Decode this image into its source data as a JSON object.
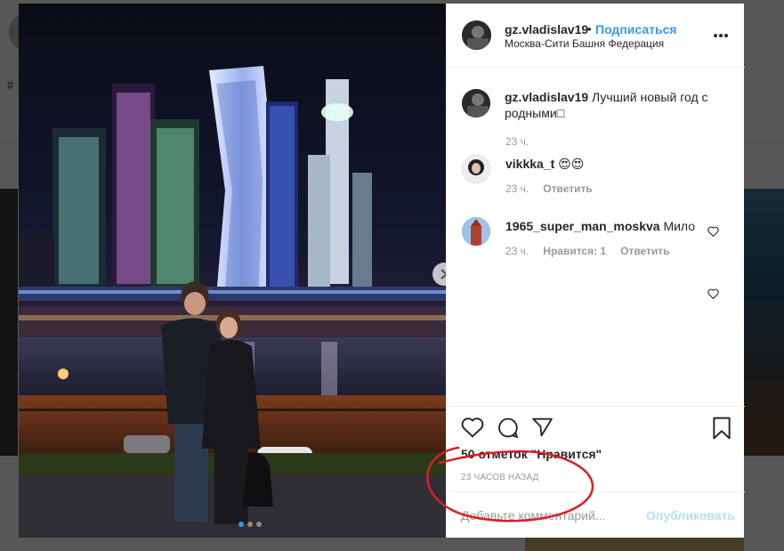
{
  "header": {
    "username": "gz.vladislav19",
    "separator": "•",
    "follow_label": "Подписаться",
    "location": "Москва-Сити Башня Федерация",
    "more_icon": "more-dots-icon"
  },
  "caption": {
    "username": "gz.vladislav19",
    "text": " Лучший новый год с родными",
    "trailing_glyph": "□",
    "time": "23 ч."
  },
  "comments": [
    {
      "username": "vikkka_t",
      "text": " 😍😍",
      "time": "23 ч.",
      "actions": [
        "Ответить"
      ]
    },
    {
      "username": "1965_super_man_moskva",
      "text": " Мило",
      "time": "23 ч.",
      "actions": [
        "Нравится: 1",
        "Ответить"
      ]
    }
  ],
  "actions": {
    "likes": "50 отметок \"Нравится\"",
    "time_ago": "23 ЧАСОВ НАЗАД"
  },
  "add_comment": {
    "placeholder": "Добавьте комментарий...",
    "publish_label": "Опубликовать"
  },
  "carousel": {
    "slide_count": 3,
    "active_index": 0
  },
  "background_page": {
    "hashtag": "#"
  },
  "colors": {
    "accent": "#3897f0",
    "publish_disabled": "#b2dffc",
    "annotation": "#d81f26"
  }
}
